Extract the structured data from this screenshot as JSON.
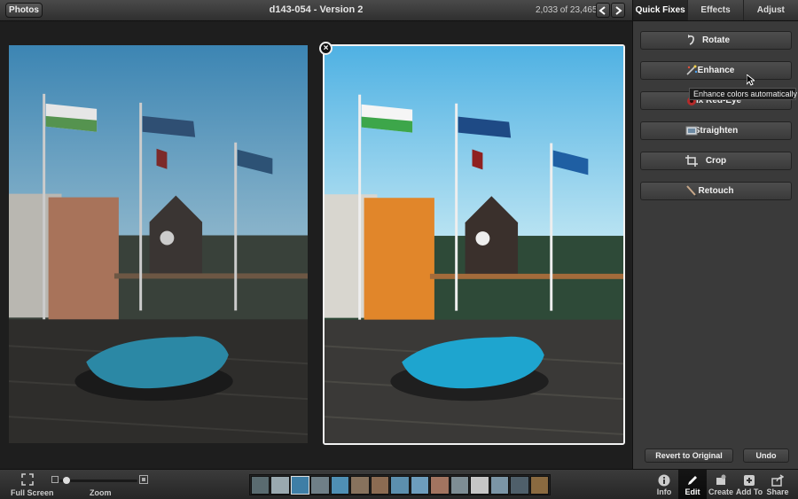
{
  "header": {
    "back_label": "Photos",
    "title": "d143-054 - Version 2",
    "counter": "2,033 of 23,465",
    "prev_icon": "arrow-left-icon",
    "next_icon": "arrow-right-icon"
  },
  "panel": {
    "tabs": [
      {
        "label": "Quick Fixes",
        "active": true
      },
      {
        "label": "Effects",
        "active": false
      },
      {
        "label": "Adjust",
        "active": false
      }
    ],
    "fixes": [
      {
        "label": "Rotate",
        "icon": "rotate-icon"
      },
      {
        "label": "Enhance",
        "icon": "magic-wand-icon"
      },
      {
        "label": "Fix Red-Eye",
        "icon": "red-eye-icon"
      },
      {
        "label": "Straighten",
        "icon": "straighten-icon"
      },
      {
        "label": "Crop",
        "icon": "crop-icon"
      },
      {
        "label": "Retouch",
        "icon": "brush-icon"
      }
    ],
    "tooltip": "Enhance colors automatically",
    "revert_label": "Revert to Original",
    "undo_label": "Undo"
  },
  "bottombar": {
    "fullscreen_label": "Full Screen",
    "zoom_label": "Zoom",
    "zoom_level": 0.05,
    "tools": [
      {
        "label": "Info",
        "icon": "info-icon",
        "active": false
      },
      {
        "label": "Edit",
        "icon": "pencil-icon",
        "active": true
      },
      {
        "label": "Create",
        "icon": "create-icon",
        "active": false
      },
      {
        "label": "Add To",
        "icon": "add-to-icon",
        "active": false
      },
      {
        "label": "Share",
        "icon": "share-icon",
        "active": false
      }
    ]
  },
  "colors": {
    "sky_before": "#4a8fb8",
    "sky_after": "#5fb6e6",
    "accent_active": "#0d0d0d"
  }
}
